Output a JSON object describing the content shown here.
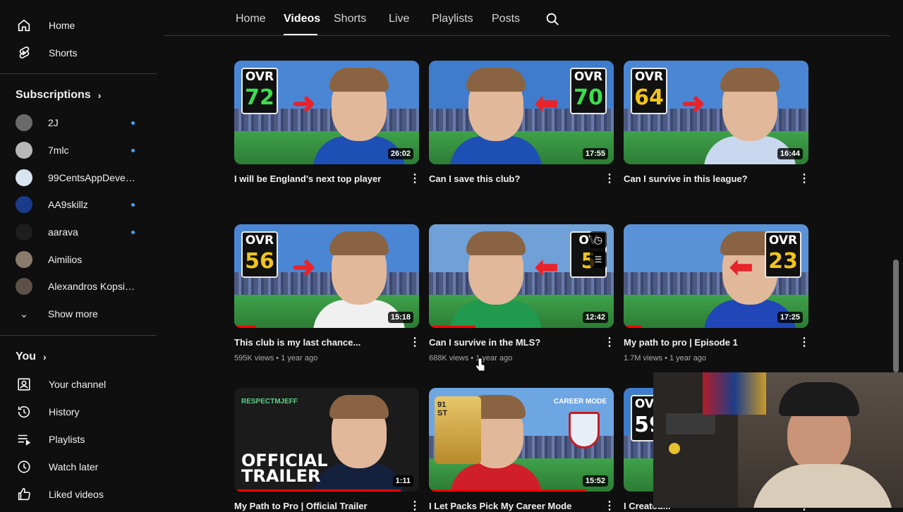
{
  "sidebar": {
    "primary": [
      {
        "label": "Home",
        "icon": "home-icon"
      },
      {
        "label": "Shorts",
        "icon": "shorts-icon"
      }
    ],
    "subscriptions_title": "Subscriptions",
    "subscriptions": [
      {
        "name": "2J",
        "new": true,
        "color": "#6a6a6a"
      },
      {
        "name": "7mlc",
        "new": true,
        "color": "#b8b8b8"
      },
      {
        "name": "99CentsAppDevelo...",
        "new": false,
        "color": "#d8e4ef"
      },
      {
        "name": "AA9skillz",
        "new": true,
        "color": "#1a3a8a"
      },
      {
        "name": "aarava",
        "new": true,
        "color": "#1e1e1e"
      },
      {
        "name": "Aimilios",
        "new": false,
        "color": "#8a7b6d"
      },
      {
        "name": "Alexandros Kopsialis",
        "new": false,
        "color": "#5c5048"
      }
    ],
    "show_more": "Show more",
    "you_title": "You",
    "you_items": [
      {
        "label": "Your channel",
        "icon": "your-channel-icon"
      },
      {
        "label": "History",
        "icon": "history-icon"
      },
      {
        "label": "Playlists",
        "icon": "playlists-icon"
      },
      {
        "label": "Watch later",
        "icon": "watch-later-icon"
      },
      {
        "label": "Liked videos",
        "icon": "liked-videos-icon"
      }
    ]
  },
  "tabs": {
    "items": [
      "Home",
      "Videos",
      "Shorts",
      "Live",
      "Playlists",
      "Posts"
    ],
    "active": "Videos"
  },
  "videos": [
    {
      "title": "I will be England's next top player",
      "meta": "",
      "duration": "26:02",
      "ovr_label": "OVR",
      "ovr": "72",
      "ovr_color": "#3ddc4f",
      "sky": "#4a86d4",
      "shirt": "#1e4fb4",
      "progress": 0
    },
    {
      "title": "Can I save this club?",
      "meta": "",
      "duration": "17:55",
      "ovr_label": "OVR",
      "ovr": "70",
      "ovr_color": "#3ddc4f",
      "sky": "#3f7ccc",
      "shirt": "#1e4fb4",
      "progress": 0
    },
    {
      "title": "Can I survive in this league?",
      "meta": "",
      "duration": "16:44",
      "ovr_label": "OVR",
      "ovr": "64",
      "ovr_color": "#f0c419",
      "sky": "#4a86d4",
      "shirt": "#c9d8ef",
      "progress": 0
    },
    {
      "title": "This club is my last chance...",
      "meta": "595K views • 1 year ago",
      "duration": "15:18",
      "ovr_label": "OVR",
      "ovr": "56",
      "ovr_color": "#f0c419",
      "sky": "#4a86d4",
      "shirt": "#f0f0f0",
      "progress": 0.12
    },
    {
      "title": "Can I survive in the MLS?",
      "meta": "688K views • 1 year ago",
      "duration": "12:42",
      "ovr_label": "OV",
      "ovr": "5",
      "ovr_color": "#f0c419",
      "sky": "#6fa0d8",
      "shirt": "#1f9a4e",
      "progress": 0.25
    },
    {
      "title": "My path to pro | Episode 1",
      "meta": "1.7M views • 1 year ago",
      "duration": "17:25",
      "ovr_label": "OVR",
      "ovr": "23",
      "ovr_color": "#f0c419",
      "sky": "#5a92d8",
      "shirt": "#2046b8",
      "progress": 0.1
    },
    {
      "title": "My Path to Pro | Official Trailer",
      "meta": "",
      "duration": "1:11",
      "ovr_label": "",
      "ovr": "",
      "ovr_color": "#ffffff",
      "sky": "#1b1b1b",
      "shirt": "#14213d",
      "progress": 0.9,
      "brand": "RESPECTMJEFF",
      "trailer": "OFFICIAL TRAILER"
    },
    {
      "title": "I Let Packs Pick My Career Mode",
      "meta": "",
      "duration": "15:52",
      "ovr_label": "",
      "ovr": "",
      "ovr_color": "#ffffff",
      "sky": "#6ea6e4",
      "shirt": "#d01f28",
      "progress": 0.85,
      "card_rating": "91 ST",
      "career_mode": "CAREER MODE"
    },
    {
      "title": "I Created...",
      "meta": "",
      "duration": "",
      "ovr_label": "OVR",
      "ovr": "59",
      "ovr_color": "#ffffff",
      "sky": "#3f7ccc",
      "shirt": "#2046b8",
      "progress": 0
    }
  ]
}
